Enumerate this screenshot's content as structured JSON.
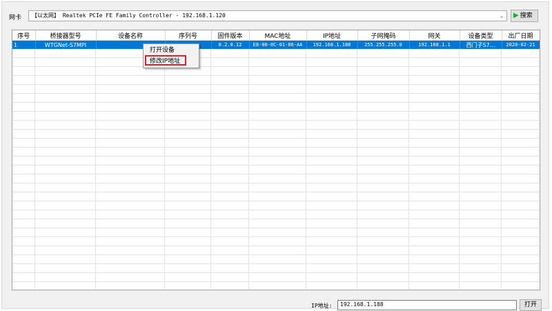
{
  "nic": {
    "label": "网卡",
    "selected": "【以太网】 Realtek PCIe FE Family Controller - 192.168.1.120",
    "arrow_icon": "chevron-down-icon"
  },
  "search_button": {
    "label": "搜索",
    "icon": "play-icon",
    "icon_color": "#1fa83a"
  },
  "table": {
    "columns": [
      "序号",
      "桥接器型号",
      "设备名称",
      "序列号",
      "固件版本",
      "MAC地址",
      "IP地址",
      "子网掩码",
      "网关",
      "设备类型",
      "出厂日期"
    ],
    "rows": [
      {
        "index": "1",
        "model": "WTGNet-S7MPI",
        "device_name": "",
        "serial": "",
        "firmware": "0.2.0.12",
        "mac": "E8-00-0C-01-86-AA",
        "ip": "192.168.1.188",
        "mask": "255.255.255.0",
        "gateway": "192.168.1.1",
        "type": "西门子S7...",
        "date": "2020-02-21"
      }
    ],
    "selected_color": "#0078d7"
  },
  "context_menu": {
    "items": [
      "打开设备",
      "修改IP地址"
    ],
    "highlight_color": "#d2222a"
  },
  "footer": {
    "ip_label": "IP地址:",
    "ip_value": "192.168.1.188",
    "open_button": "打开"
  }
}
